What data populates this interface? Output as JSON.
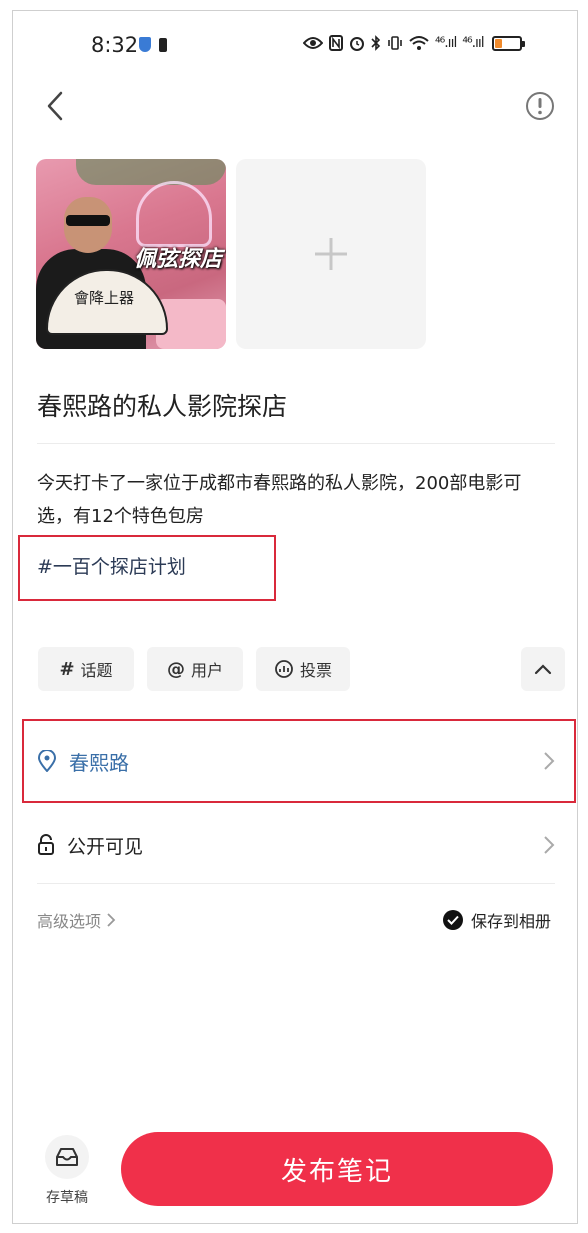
{
  "status_bar": {
    "time": "8:32",
    "signal_1": "⁴⁶.ııl",
    "signal_2": "⁴⁶.ııl"
  },
  "media": {
    "thumbnail_overlay_text": "佩弦探店",
    "fan_text": "會降上器"
  },
  "note": {
    "title": "春熙路的私人影院探店",
    "description": "今天打卡了一家位于成都市春熙路的私人影院，200部电影可选，有12个特色包房",
    "hashtag": "#一百个探店计划"
  },
  "toolbar": {
    "topic_label": "话题",
    "topic_symbol": "#",
    "user_label": "用户",
    "user_symbol": "@",
    "vote_label": "投票"
  },
  "location": {
    "label": "春熙路"
  },
  "visibility": {
    "label": "公开可见"
  },
  "options": {
    "advanced_label": "高级选项",
    "save_album_label": "保存到相册"
  },
  "footer": {
    "draft_label": "存草稿",
    "publish_label": "发布笔记"
  },
  "colors": {
    "accent": "#f0304a",
    "highlight_box": "#d9293b",
    "location_text": "#3a6fa8"
  }
}
